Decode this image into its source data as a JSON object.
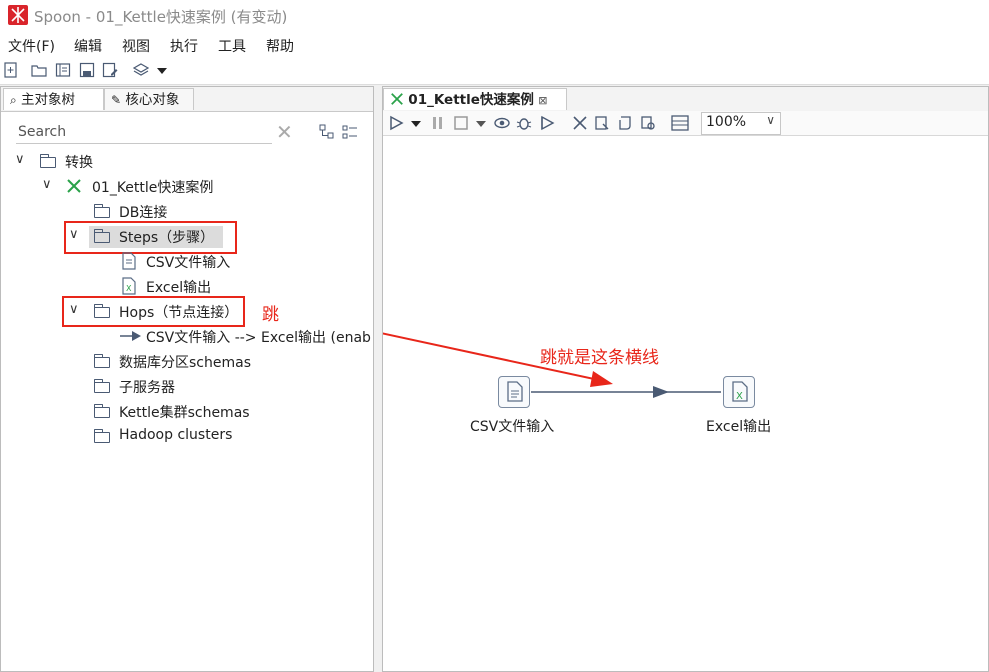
{
  "window": {
    "title": "Spoon - 01_Kettle快速案例 (有变动)"
  },
  "menu": [
    "文件(F)",
    "编辑",
    "视图",
    "执行",
    "工具",
    "帮助"
  ],
  "left_tabs": {
    "main_tree": "主对象树",
    "core_objects": "核心对象"
  },
  "search": {
    "placeholder": "Search"
  },
  "tree": {
    "transform": "转换",
    "trans_name": "01_Kettle快速案例",
    "db_conn": "DB连接",
    "steps": "Steps（步骤）",
    "step_csv": "CSV文件输入",
    "step_excel": "Excel输出",
    "hops": "Hops（节点连接）",
    "hop_item": "CSV文件输入 --> Excel输出 (enab",
    "partitions": "数据库分区schemas",
    "slave_servers": "子服务器",
    "cluster": "Kettle集群schemas",
    "hadoop": "Hadoop clusters"
  },
  "editor_tab": {
    "label": "01_Kettle快速案例"
  },
  "zoom": {
    "value": "100%"
  },
  "canvas": {
    "step1": "CSV文件输入",
    "step2": "Excel输出"
  },
  "annotations": {
    "hop_char": "跳",
    "hop_note": "跳就是这条横线",
    "color": "#e8261a"
  }
}
